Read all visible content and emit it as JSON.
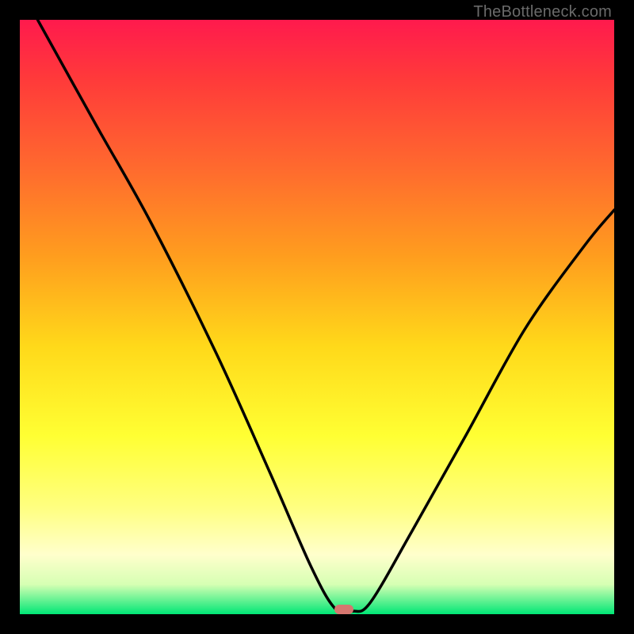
{
  "watermark": "TheBottleneck.com",
  "chart_data": {
    "type": "line",
    "title": "",
    "xlabel": "",
    "ylabel": "",
    "xlim": [
      0,
      100
    ],
    "ylim": [
      0,
      100
    ],
    "grid": false,
    "legend": false,
    "series": [
      {
        "name": "bottleneck-curve",
        "points": [
          {
            "x": 3,
            "y": 100
          },
          {
            "x": 13,
            "y": 82
          },
          {
            "x": 22,
            "y": 66
          },
          {
            "x": 33,
            "y": 44
          },
          {
            "x": 42,
            "y": 24
          },
          {
            "x": 49,
            "y": 8
          },
          {
            "x": 53,
            "y": 1
          },
          {
            "x": 56,
            "y": 0.5
          },
          {
            "x": 59,
            "y": 2
          },
          {
            "x": 66,
            "y": 14
          },
          {
            "x": 75,
            "y": 30
          },
          {
            "x": 85,
            "y": 48
          },
          {
            "x": 95,
            "y": 62
          },
          {
            "x": 100,
            "y": 68
          }
        ]
      }
    ],
    "marker": {
      "x": 54.5,
      "y": 0.8,
      "width_pct": 3.2,
      "height_pct": 1.6
    },
    "colors": {
      "curve": "#000000",
      "marker": "#d6766f",
      "gradient_top": "#ff1a4d",
      "gradient_bottom": "#00e676"
    }
  }
}
